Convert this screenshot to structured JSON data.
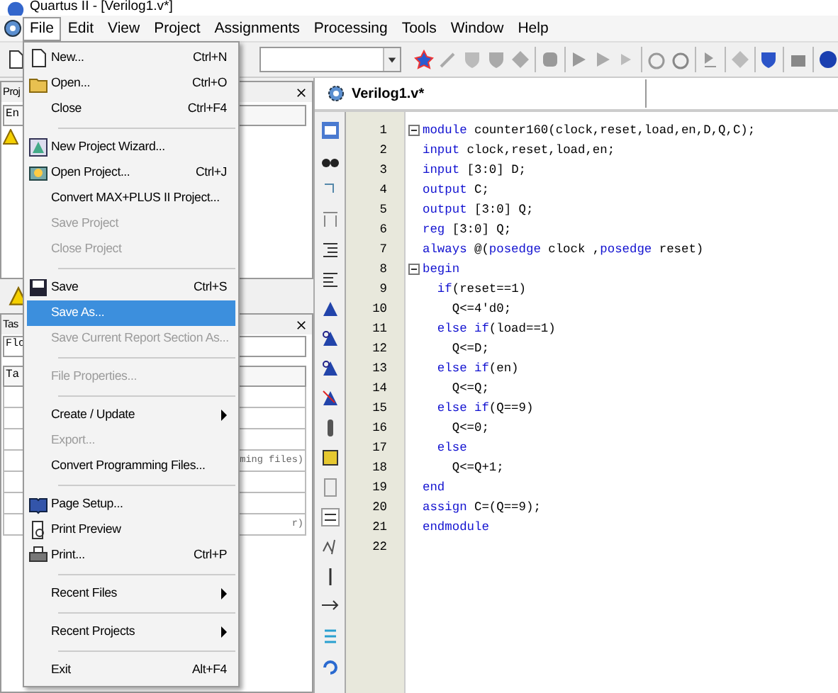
{
  "window": {
    "title": "Quartus II - [Verilog1.v*]"
  },
  "menu_bar": [
    {
      "label": "File",
      "selected": true
    },
    {
      "label": "Edit",
      "selected": false
    },
    {
      "label": "View",
      "selected": false
    },
    {
      "label": "Project",
      "selected": false
    },
    {
      "label": "Assignments",
      "selected": false
    },
    {
      "label": "Processing",
      "selected": false
    },
    {
      "label": "Tools",
      "selected": false
    },
    {
      "label": "Window",
      "selected": false
    },
    {
      "label": "Help",
      "selected": false
    }
  ],
  "file_menu": [
    {
      "kind": "item",
      "label": "New...",
      "shortcut": "Ctrl+N",
      "disabled": false,
      "selected": false,
      "submenu": false
    },
    {
      "kind": "item",
      "label": "Open...",
      "shortcut": "Ctrl+O",
      "disabled": false,
      "selected": false,
      "submenu": false
    },
    {
      "kind": "item",
      "label": "Close",
      "shortcut": "Ctrl+F4",
      "disabled": false,
      "selected": false,
      "submenu": false
    },
    {
      "kind": "separator"
    },
    {
      "kind": "item",
      "label": "New Project Wizard...",
      "disabled": false,
      "selected": false,
      "submenu": false
    },
    {
      "kind": "item",
      "label": "Open Project...",
      "shortcut": "Ctrl+J",
      "disabled": false,
      "selected": false,
      "submenu": false
    },
    {
      "kind": "item",
      "label": "Convert MAX+PLUS II Project...",
      "disabled": false,
      "selected": false,
      "submenu": false
    },
    {
      "kind": "item",
      "label": "Save Project",
      "disabled": true,
      "selected": false,
      "submenu": false
    },
    {
      "kind": "item",
      "label": "Close Project",
      "disabled": true,
      "selected": false,
      "submenu": false
    },
    {
      "kind": "separator"
    },
    {
      "kind": "item",
      "label": "Save",
      "shortcut": "Ctrl+S",
      "disabled": false,
      "selected": false,
      "submenu": false
    },
    {
      "kind": "item",
      "label": "Save As...",
      "disabled": false,
      "selected": true,
      "submenu": false
    },
    {
      "kind": "item",
      "label": "Save Current Report Section As...",
      "disabled": true,
      "selected": false,
      "submenu": false
    },
    {
      "kind": "separator"
    },
    {
      "kind": "item",
      "label": "File Properties...",
      "disabled": true,
      "selected": false,
      "submenu": false
    },
    {
      "kind": "separator"
    },
    {
      "kind": "item",
      "label": "Create / Update",
      "disabled": false,
      "selected": false,
      "submenu": true
    },
    {
      "kind": "item",
      "label": "Export...",
      "disabled": true,
      "selected": false,
      "submenu": false
    },
    {
      "kind": "item",
      "label": "Convert Programming Files...",
      "disabled": false,
      "selected": false,
      "submenu": false
    },
    {
      "kind": "separator"
    },
    {
      "kind": "item",
      "label": "Page Setup...",
      "disabled": false,
      "selected": false,
      "submenu": false
    },
    {
      "kind": "item",
      "label": "Print Preview",
      "disabled": false,
      "selected": false,
      "submenu": false
    },
    {
      "kind": "item",
      "label": "Print...",
      "shortcut": "Ctrl+P",
      "disabled": false,
      "selected": false,
      "submenu": false
    },
    {
      "kind": "separator"
    },
    {
      "kind": "item",
      "label": "Recent Files",
      "disabled": false,
      "selected": false,
      "submenu": true
    },
    {
      "kind": "separator"
    },
    {
      "kind": "item",
      "label": "Recent Projects",
      "disabled": false,
      "selected": false,
      "submenu": true
    },
    {
      "kind": "separator"
    },
    {
      "kind": "item",
      "label": "Exit",
      "shortcut": "Alt+F4",
      "disabled": false,
      "selected": false,
      "submenu": false
    }
  ],
  "project_navigator": {
    "title": "Proj",
    "column_1": "En"
  },
  "tasks": {
    "title": "Tas",
    "flow": "Flo",
    "column_1": "Ta",
    "rows": [
      {
        "kind": "blank"
      },
      {
        "kind": "blank"
      },
      {
        "kind": "blank"
      },
      {
        "kind": "text",
        "text": "ming files)"
      },
      {
        "kind": "blank"
      },
      {
        "kind": "blank"
      },
      {
        "kind": "text",
        "text": "r)"
      }
    ]
  },
  "editor": {
    "tab": {
      "label": "Verilog1.v*",
      "selected": true
    },
    "lines": [
      {
        "number": "1",
        "fold": true,
        "segments": [
          {
            "kind": "keyword",
            "text": "module"
          },
          {
            "kind": "plain",
            "text": " counter160(clock,reset,load,en,D,Q,C);"
          }
        ]
      },
      {
        "number": "2",
        "fold": false,
        "segments": [
          {
            "kind": "keyword",
            "text": "input"
          },
          {
            "kind": "plain",
            "text": " clock,reset,load,en;"
          }
        ]
      },
      {
        "number": "3",
        "fold": false,
        "segments": [
          {
            "kind": "keyword",
            "text": "input"
          },
          {
            "kind": "plain",
            "text": " [3:0] D;"
          }
        ]
      },
      {
        "number": "4",
        "fold": false,
        "segments": [
          {
            "kind": "keyword",
            "text": "output"
          },
          {
            "kind": "plain",
            "text": " C;"
          }
        ]
      },
      {
        "number": "5",
        "fold": false,
        "segments": [
          {
            "kind": "keyword",
            "text": "output"
          },
          {
            "kind": "plain",
            "text": " [3:0] Q;"
          }
        ]
      },
      {
        "number": "6",
        "fold": false,
        "segments": [
          {
            "kind": "keyword",
            "text": "reg"
          },
          {
            "kind": "plain",
            "text": " [3:0] Q;"
          }
        ]
      },
      {
        "number": "7",
        "fold": false,
        "segments": [
          {
            "kind": "keyword",
            "text": "always"
          },
          {
            "kind": "plain",
            "text": " @("
          },
          {
            "kind": "keyword",
            "text": "posedge"
          },
          {
            "kind": "plain",
            "text": " clock ,"
          },
          {
            "kind": "keyword",
            "text": "posedge"
          },
          {
            "kind": "plain",
            "text": " reset)"
          }
        ]
      },
      {
        "number": "8",
        "fold": true,
        "segments": [
          {
            "kind": "keyword",
            "text": "begin"
          }
        ]
      },
      {
        "number": "9",
        "fold": false,
        "segments": [
          {
            "kind": "keyword",
            "text": "  if"
          },
          {
            "kind": "plain",
            "text": "(reset==1)"
          }
        ]
      },
      {
        "number": "10",
        "fold": false,
        "segments": [
          {
            "kind": "plain",
            "text": "    Q<=4'd0;"
          }
        ]
      },
      {
        "number": "11",
        "fold": false,
        "segments": [
          {
            "kind": "keyword",
            "text": "  else if"
          },
          {
            "kind": "plain",
            "text": "(load==1)"
          }
        ]
      },
      {
        "number": "12",
        "fold": false,
        "segments": [
          {
            "kind": "plain",
            "text": "    Q<=D;"
          }
        ]
      },
      {
        "number": "13",
        "fold": false,
        "segments": [
          {
            "kind": "keyword",
            "text": "  else if"
          },
          {
            "kind": "plain",
            "text": "(en)"
          }
        ]
      },
      {
        "number": "14",
        "fold": false,
        "segments": [
          {
            "kind": "plain",
            "text": "    Q<=Q;"
          }
        ]
      },
      {
        "number": "15",
        "fold": false,
        "segments": [
          {
            "kind": "keyword",
            "text": "  else if"
          },
          {
            "kind": "plain",
            "text": "(Q==9)"
          }
        ]
      },
      {
        "number": "16",
        "fold": false,
        "segments": [
          {
            "kind": "plain",
            "text": "    Q<=0;"
          }
        ]
      },
      {
        "number": "17",
        "fold": false,
        "segments": [
          {
            "kind": "keyword",
            "text": "  else"
          }
        ]
      },
      {
        "number": "18",
        "fold": false,
        "segments": [
          {
            "kind": "plain",
            "text": "    Q<=Q+1;"
          }
        ]
      },
      {
        "number": "19",
        "fold": false,
        "segments": [
          {
            "kind": "keyword",
            "text": "end"
          }
        ]
      },
      {
        "number": "20",
        "fold": false,
        "segments": [
          {
            "kind": "keyword",
            "text": "assign"
          },
          {
            "kind": "plain",
            "text": " C=(Q==9);"
          }
        ]
      },
      {
        "number": "21",
        "fold": false,
        "segments": [
          {
            "kind": "keyword",
            "text": "endmodule"
          }
        ]
      },
      {
        "number": "22",
        "fold": false
      }
    ]
  }
}
